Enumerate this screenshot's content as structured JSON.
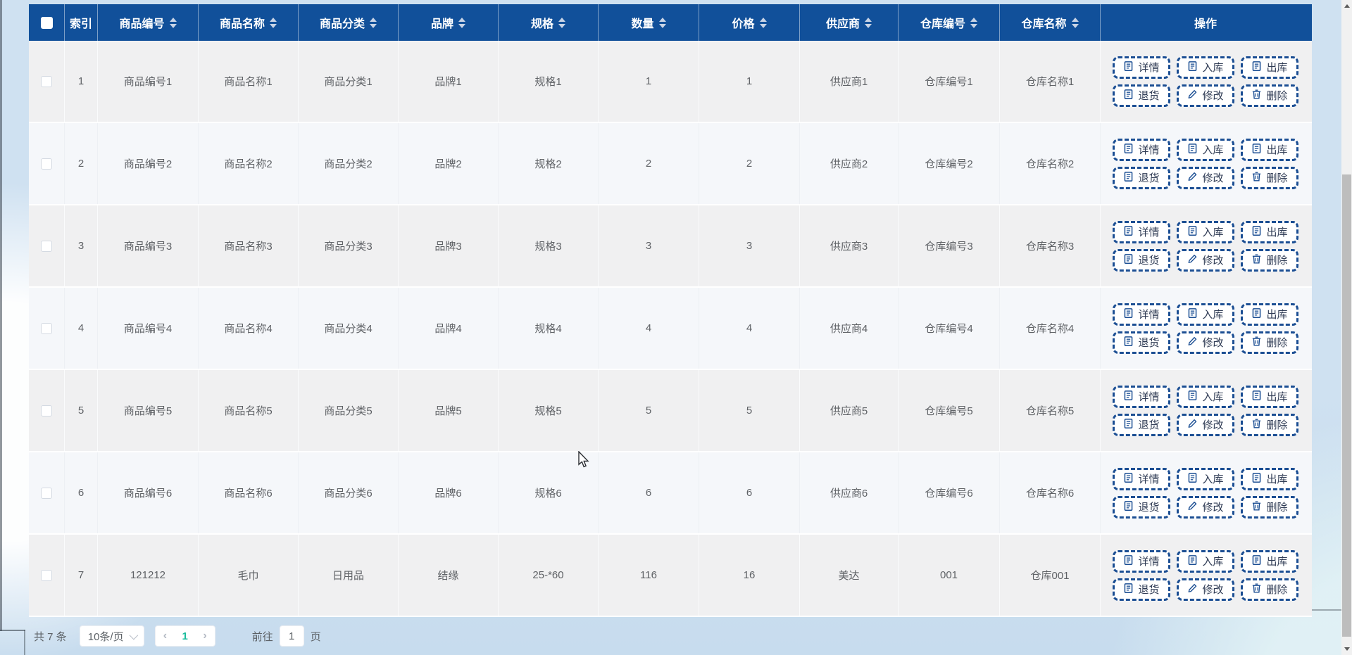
{
  "colors": {
    "header_bg": "#11509a",
    "accent_blue": "#1b4e93",
    "active_page_teal": "#1abc9c",
    "page_bg": "#cfe1f1",
    "row_stripe_gray": "#f0f0f1",
    "row_stripe_light": "#f5f7fa"
  },
  "table": {
    "header": {
      "select_all_state": "unchecked",
      "columns": [
        {
          "key": "index",
          "label": "索引",
          "sortable": false
        },
        {
          "key": "code",
          "label": "商品编号",
          "sortable": true
        },
        {
          "key": "name",
          "label": "商品名称",
          "sortable": true
        },
        {
          "key": "category",
          "label": "商品分类",
          "sortable": true
        },
        {
          "key": "brand",
          "label": "品牌",
          "sortable": true
        },
        {
          "key": "spec",
          "label": "规格",
          "sortable": true
        },
        {
          "key": "qty",
          "label": "数量",
          "sortable": true
        },
        {
          "key": "price",
          "label": "价格",
          "sortable": true
        },
        {
          "key": "supplier",
          "label": "供应商",
          "sortable": true
        },
        {
          "key": "wh_code",
          "label": "仓库编号",
          "sortable": true
        },
        {
          "key": "wh_name",
          "label": "仓库名称",
          "sortable": true
        },
        {
          "key": "ops",
          "label": "操作",
          "sortable": false
        }
      ]
    },
    "action_buttons": [
      {
        "label": "详情",
        "icon": "document-icon"
      },
      {
        "label": "入库",
        "icon": "document-icon"
      },
      {
        "label": "出库",
        "icon": "document-icon"
      },
      {
        "label": "退货",
        "icon": "document-icon"
      },
      {
        "label": "修改",
        "icon": "edit-icon"
      },
      {
        "label": "删除",
        "icon": "delete-icon"
      }
    ],
    "rows": [
      {
        "index": "1",
        "code": "商品编号1",
        "name": "商品名称1",
        "category": "商品分类1",
        "brand": "品牌1",
        "spec": "规格1",
        "qty": "1",
        "price": "1",
        "supplier": "供应商1",
        "wh_code": "仓库编号1",
        "wh_name": "仓库名称1",
        "checked": false
      },
      {
        "index": "2",
        "code": "商品编号2",
        "name": "商品名称2",
        "category": "商品分类2",
        "brand": "品牌2",
        "spec": "规格2",
        "qty": "2",
        "price": "2",
        "supplier": "供应商2",
        "wh_code": "仓库编号2",
        "wh_name": "仓库名称2",
        "checked": false
      },
      {
        "index": "3",
        "code": "商品编号3",
        "name": "商品名称3",
        "category": "商品分类3",
        "brand": "品牌3",
        "spec": "规格3",
        "qty": "3",
        "price": "3",
        "supplier": "供应商3",
        "wh_code": "仓库编号3",
        "wh_name": "仓库名称3",
        "checked": false
      },
      {
        "index": "4",
        "code": "商品编号4",
        "name": "商品名称4",
        "category": "商品分类4",
        "brand": "品牌4",
        "spec": "规格4",
        "qty": "4",
        "price": "4",
        "supplier": "供应商4",
        "wh_code": "仓库编号4",
        "wh_name": "仓库名称4",
        "checked": false
      },
      {
        "index": "5",
        "code": "商品编号5",
        "name": "商品名称5",
        "category": "商品分类5",
        "brand": "品牌5",
        "spec": "规格5",
        "qty": "5",
        "price": "5",
        "supplier": "供应商5",
        "wh_code": "仓库编号5",
        "wh_name": "仓库名称5",
        "checked": false
      },
      {
        "index": "6",
        "code": "商品编号6",
        "name": "商品名称6",
        "category": "商品分类6",
        "brand": "品牌6",
        "spec": "规格6",
        "qty": "6",
        "price": "6",
        "supplier": "供应商6",
        "wh_code": "仓库编号6",
        "wh_name": "仓库名称6",
        "checked": false
      },
      {
        "index": "7",
        "code": "121212",
        "name": "毛巾",
        "category": "日用品",
        "brand": "结缘",
        "spec": "25-*60",
        "qty": "116",
        "price": "16",
        "supplier": "美达",
        "wh_code": "001",
        "wh_name": "仓库001",
        "checked": false
      }
    ]
  },
  "pagination": {
    "total_text": "共 7 条",
    "page_size_selected": "10条/页",
    "current_page": "1",
    "goto_label": "前往",
    "goto_input_value": "1",
    "goto_unit": "页"
  }
}
